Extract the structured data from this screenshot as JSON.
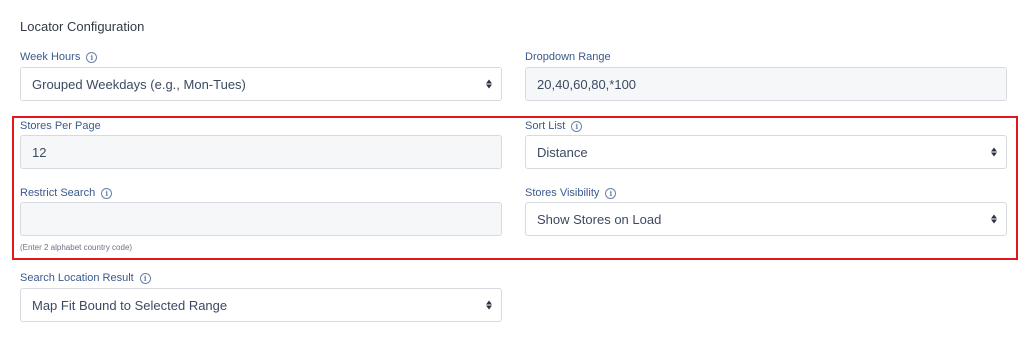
{
  "section": {
    "title": "Locator Configuration"
  },
  "fields": {
    "week_hours": {
      "label": "Week Hours",
      "value": "Grouped Weekdays (e.g., Mon-Tues)"
    },
    "dropdown_range": {
      "label": "Dropdown Range",
      "value": "20,40,60,80,*100"
    },
    "stores_per_page": {
      "label": "Stores Per Page",
      "value": "12"
    },
    "sort_list": {
      "label": "Sort List",
      "value": "Distance"
    },
    "restrict_search": {
      "label": "Restrict Search",
      "value": "",
      "helper": "(Enter 2 alphabet country code)"
    },
    "stores_visibility": {
      "label": "Stores Visibility",
      "value": "Show Stores on Load"
    },
    "search_location_result": {
      "label": "Search Location Result",
      "value": "Map Fit Bound to Selected Range"
    }
  },
  "icons": {
    "info": "i"
  },
  "colors": {
    "highlight": "#e3161b",
    "label": "#3a5a8c"
  }
}
